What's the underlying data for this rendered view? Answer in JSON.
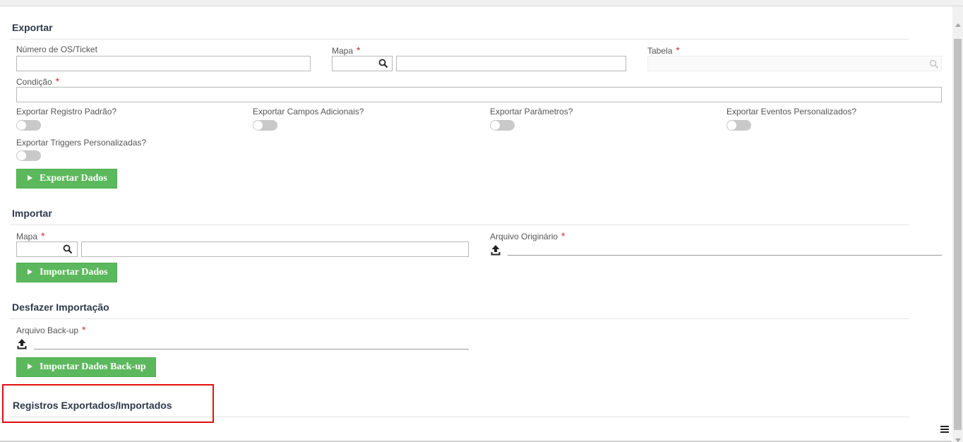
{
  "export": {
    "title": "Exportar",
    "ticket_label": "Número de OS/Ticket",
    "ticket_value": "",
    "map_label": "Mapa",
    "map_code": "",
    "map_description": "",
    "table_label": "Tabela",
    "table_value": "",
    "condition_label": "Condição",
    "condition_value": "",
    "options": [
      {
        "label": "Exportar Registro Padrão?",
        "checked": false
      },
      {
        "label": "Exportar Campos Adicionais?",
        "checked": false
      },
      {
        "label": "Exportar Parâmetros?",
        "checked": false
      },
      {
        "label": "Exportar Eventos Personalizados?",
        "checked": false
      },
      {
        "label": "Exportar Triggers Personalizadas?",
        "checked": false
      }
    ],
    "button_label": "Exportar Dados"
  },
  "import": {
    "title": "Importar",
    "map_label": "Mapa",
    "map_code": "",
    "map_description": "",
    "file_label": "Arquivo Originário",
    "button_label": "Importar Dados"
  },
  "undo": {
    "title": "Desfazer Importação",
    "file_label": "Arquivo Back-up",
    "button_label": "Importar Dados Back-up"
  },
  "records": {
    "title": "Registros Exportados/Importados"
  },
  "required_mark": "*",
  "colors": {
    "primary_button": "#5cb85c",
    "required": "#c9302c",
    "highlight": "#e01010"
  }
}
